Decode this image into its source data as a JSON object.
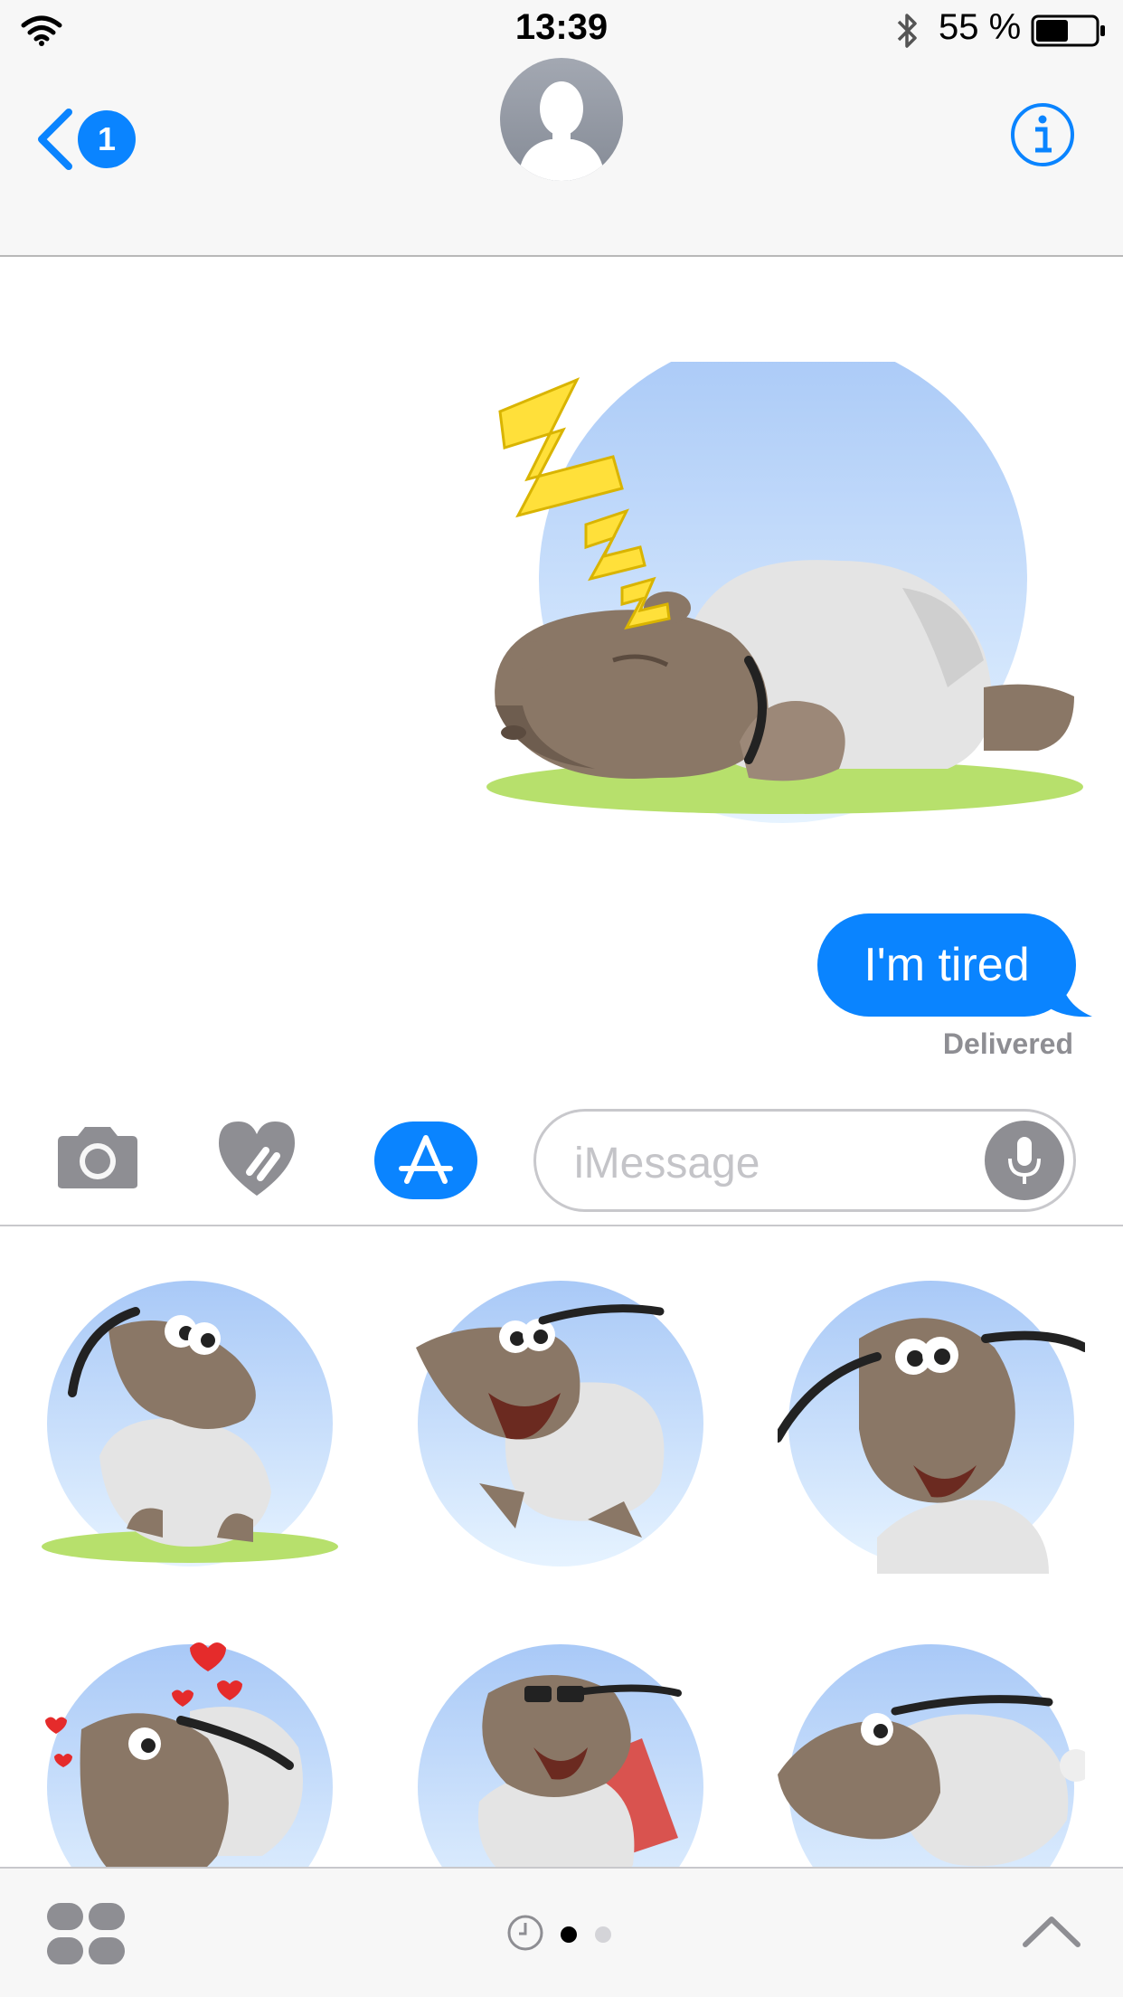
{
  "status_bar": {
    "time": "13:39",
    "battery_percent": "55 %",
    "battery_level": 0.55,
    "icons": [
      "wifi-icon",
      "bluetooth-icon",
      "battery-icon"
    ]
  },
  "nav": {
    "back_badge": "1",
    "icons": [
      "back-chevron-icon",
      "contact-avatar",
      "info-icon"
    ]
  },
  "conversation": {
    "sticker_sent": "sleeping-hippo-sticker",
    "message_text": "I'm tired",
    "message_status": "Delivered"
  },
  "input_bar": {
    "placeholder": "iMessage",
    "icons": [
      "camera-icon",
      "digital-touch-heart-icon",
      "app-store-icon",
      "microphone-icon"
    ]
  },
  "sticker_drawer": {
    "stickers": [
      "hippo-sitting-sticker",
      "hippo-laughing-sticker",
      "hippo-smiling-sticker",
      "hippo-in-love-sticker",
      "hippo-sunglasses-sticker",
      "hippo-running-sticker"
    ],
    "page_count": 2,
    "current_page": 1
  },
  "bottom_bar": {
    "icons": [
      "app-drawer-icon",
      "recents-clock-icon",
      "expand-chevron-icon"
    ]
  },
  "colors": {
    "accent_blue": "#0a84ff",
    "bar_background": "#f7f7f7",
    "secondary_text": "#8e8e93",
    "sky_light": "#d8ecff",
    "sky_blue": "#a9c9f7",
    "hippo_brown": "#8a7766",
    "fleece_white": "#e8e8e8",
    "grass_green": "#b7e06c"
  }
}
